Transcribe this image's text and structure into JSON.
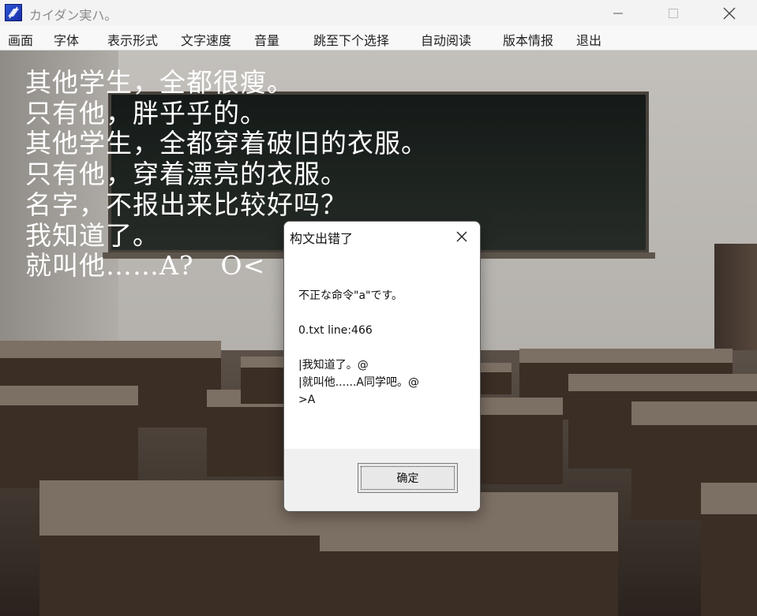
{
  "window": {
    "title": "カイダン実ハ。"
  },
  "menu": {
    "items": [
      "画面",
      "字体",
      "表示形式",
      "文字速度",
      "音量",
      "跳至下个选择",
      "自动阅读",
      "版本情报",
      "退出"
    ]
  },
  "narration": {
    "lines": [
      "其他学生，全都很瘦。",
      "只有他，胖乎乎的。",
      "其他学生，全都穿着破旧的衣服。",
      "只有他，穿着漂亮的衣服。",
      "名字，不报出来比较好吗？",
      "我知道了。",
      "就叫他……A?　O<"
    ]
  },
  "dialog": {
    "title": "构文出错了",
    "lines": [
      "不正な命令\"a\"です。",
      "0.txt line:466",
      "|我知道了。@",
      "|就叫他......A同学吧。@",
      ">A"
    ],
    "ok_label": "确定"
  },
  "colors": {
    "narration_text": "#ffffff",
    "title_text": "#8a8a8a",
    "menu_bg": "#f8f8f8",
    "dialog_footer_bg": "#f0f0f0"
  }
}
